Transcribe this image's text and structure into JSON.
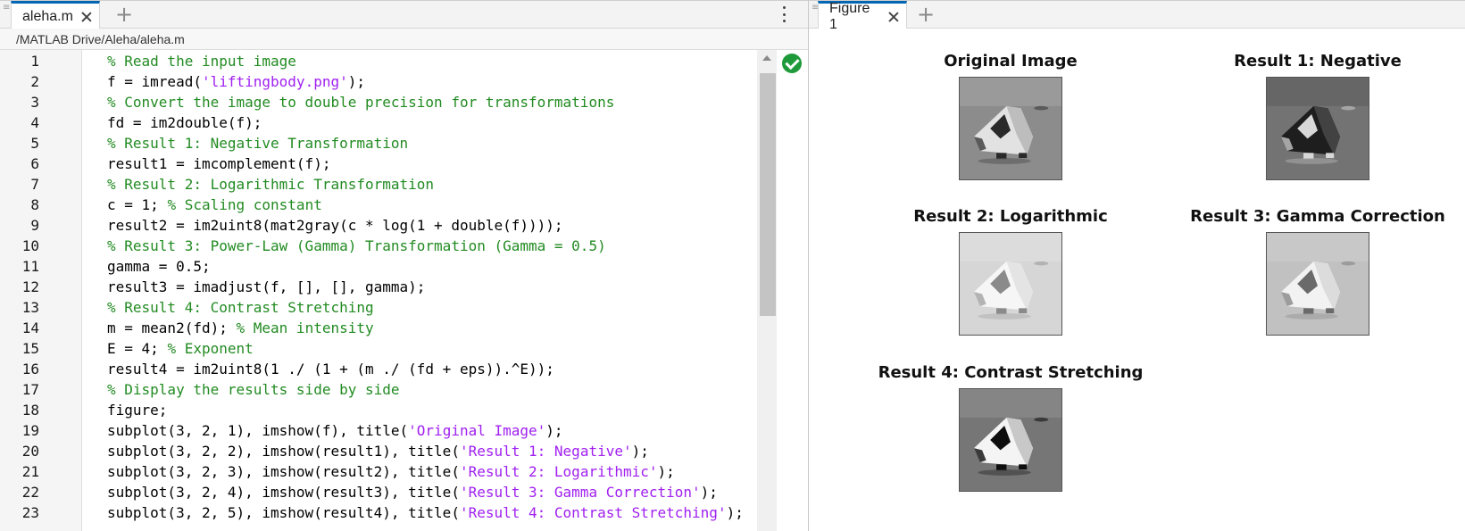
{
  "editor": {
    "tab_label": "aleha.m",
    "path": "/MATLAB Drive/Aleha/aleha.m",
    "lines": [
      {
        "n": "1",
        "parts": [
          {
            "t": "% Read the input image",
            "c": "cmt"
          }
        ]
      },
      {
        "n": "2",
        "parts": [
          {
            "t": "f = imread(",
            "c": ""
          },
          {
            "t": "'liftingbody.png'",
            "c": "str"
          },
          {
            "t": ");",
            "c": ""
          }
        ]
      },
      {
        "n": "3",
        "parts": [
          {
            "t": "% Convert the image to double precision for transformations",
            "c": "cmt"
          }
        ]
      },
      {
        "n": "4",
        "parts": [
          {
            "t": "fd = im2double(f);",
            "c": ""
          }
        ]
      },
      {
        "n": "5",
        "parts": [
          {
            "t": "% Result 1: Negative Transformation",
            "c": "cmt"
          }
        ]
      },
      {
        "n": "6",
        "parts": [
          {
            "t": "result1 = imcomplement(f);",
            "c": ""
          }
        ]
      },
      {
        "n": "7",
        "parts": [
          {
            "t": "% Result 2: Logarithmic Transformation",
            "c": "cmt"
          }
        ]
      },
      {
        "n": "8",
        "parts": [
          {
            "t": "c = 1; ",
            "c": ""
          },
          {
            "t": "% Scaling constant",
            "c": "cmt"
          }
        ]
      },
      {
        "n": "9",
        "parts": [
          {
            "t": "result2 = im2uint8(mat2gray(c * log(1 + double(f))));",
            "c": ""
          }
        ]
      },
      {
        "n": "10",
        "parts": [
          {
            "t": "% Result 3: Power-Law (Gamma) Transformation (Gamma = 0.5)",
            "c": "cmt"
          }
        ]
      },
      {
        "n": "11",
        "parts": [
          {
            "t": "gamma = 0.5;",
            "c": ""
          }
        ]
      },
      {
        "n": "12",
        "parts": [
          {
            "t": "result3 = imadjust(f, [], [], gamma);",
            "c": ""
          }
        ]
      },
      {
        "n": "13",
        "parts": [
          {
            "t": "% Result 4: Contrast Stretching",
            "c": "cmt"
          }
        ]
      },
      {
        "n": "14",
        "parts": [
          {
            "t": "m = mean2(fd); ",
            "c": ""
          },
          {
            "t": "% Mean intensity",
            "c": "cmt"
          }
        ]
      },
      {
        "n": "15",
        "parts": [
          {
            "t": "E = 4; ",
            "c": ""
          },
          {
            "t": "% Exponent",
            "c": "cmt"
          }
        ]
      },
      {
        "n": "16",
        "parts": [
          {
            "t": "result4 = im2uint8(1 ./ (1 + (m ./ (fd + eps)).^E));",
            "c": ""
          }
        ]
      },
      {
        "n": "17",
        "parts": [
          {
            "t": "% Display the results side by side",
            "c": "cmt"
          }
        ]
      },
      {
        "n": "18",
        "parts": [
          {
            "t": "figure;",
            "c": ""
          }
        ]
      },
      {
        "n": "19",
        "parts": [
          {
            "t": "subplot(3, 2, 1), imshow(f), title(",
            "c": ""
          },
          {
            "t": "'Original Image'",
            "c": "str"
          },
          {
            "t": ");",
            "c": ""
          }
        ]
      },
      {
        "n": "20",
        "parts": [
          {
            "t": "subplot(3, 2, 2), imshow(result1), title(",
            "c": ""
          },
          {
            "t": "'Result 1: Negative'",
            "c": "str"
          },
          {
            "t": ");",
            "c": ""
          }
        ]
      },
      {
        "n": "21",
        "parts": [
          {
            "t": "subplot(3, 2, 3), imshow(result2), title(",
            "c": ""
          },
          {
            "t": "'Result 2: Logarithmic'",
            "c": "str"
          },
          {
            "t": ");",
            "c": ""
          }
        ]
      },
      {
        "n": "22",
        "parts": [
          {
            "t": "subplot(3, 2, 4), imshow(result3), title(",
            "c": ""
          },
          {
            "t": "'Result 3: Gamma Correction'",
            "c": "str"
          },
          {
            "t": ");",
            "c": ""
          }
        ]
      },
      {
        "n": "23",
        "parts": [
          {
            "t": "subplot(3, 2, 5), imshow(result4), title(",
            "c": ""
          },
          {
            "t": "'Result 4: Contrast Stretching'",
            "c": "str"
          },
          {
            "t": ");",
            "c": ""
          }
        ]
      }
    ],
    "icons": {
      "grip": "drag-grip-icon",
      "close": "close-icon",
      "add": "plus-icon",
      "menu": "more-options-icon",
      "status": "check-circle-icon"
    },
    "colors": {
      "comment": "#228b22",
      "string": "#a020f0",
      "tab_accent": "#0066b3",
      "status_ok": "#1f9a3a"
    }
  },
  "figure": {
    "tab_label": "Figure 1",
    "subplots": [
      {
        "title": "Original Image",
        "variant": "original"
      },
      {
        "title": "Result 1: Negative",
        "variant": "negative"
      },
      {
        "title": "Result 2: Logarithmic",
        "variant": "log"
      },
      {
        "title": "Result 3: Gamma Correction",
        "variant": "gamma"
      },
      {
        "title": "Result 4: Contrast Stretching",
        "variant": "stretch"
      }
    ]
  }
}
